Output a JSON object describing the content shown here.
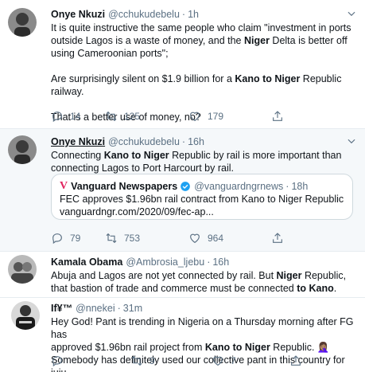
{
  "tweets": [
    {
      "name": "Onye Nkuzi",
      "handle": "@cchukudebelu",
      "time": "1h",
      "body": [
        [
          "It is quite instructive the same people who claim \"investment in ports outside Lagos is a waste of money, and the ",
          "Niger",
          " Delta is better off using Cameroonian ports\";"
        ],
        [
          "Are surprisingly silent on $1.9 billion for a ",
          "Kano to Niger",
          " Republic railway."
        ],
        [
          "That is a better use of money, no?"
        ]
      ],
      "replies": "14",
      "retweets": "125",
      "likes": "179"
    },
    {
      "name": "Onye Nkuzi",
      "handle": "@cchukudebelu",
      "time": "16h",
      "body_a": "Connecting ",
      "body_b": "Kano to Niger",
      "body_c": " Republic by rail is more important than connecting Lagos to Port Harcourt by rail.",
      "quote": {
        "source": "Vanguard Newspapers",
        "handle": "@vanguardngrnews",
        "time": "18h",
        "text": "FEC approves $1.96bn rail contract from Kano to Niger Republic",
        "link": "vanguardngr.com/2020/09/fec-ap..."
      },
      "replies": "79",
      "retweets": "753",
      "likes": "964"
    },
    {
      "name": "Kamala Obama",
      "handle": "@Ambrosia_ljebu",
      "time": "16h",
      "body_a": "Abuja and Lagos are not yet connected by rail. But ",
      "body_b": "Niger",
      "body_c": " Republic, that bastion of trade and commerce must be connected ",
      "body_d": "to Kano",
      "body_e": "."
    },
    {
      "name": "If¥™",
      "handle": "@nnekei",
      "time": "31m",
      "line1": "Hey God! Pant is trending in Nigeria on a Thursday morning after FG has",
      "line2a": "approved $1.96bn rail project from ",
      "line2b": "Kano to Niger",
      "line2c": " Republic. 🤦🏽‍♀️",
      "line3": "Somebody has definitely used our collective pant in this country for juju.",
      "retweets": "9",
      "likes": "7"
    }
  ],
  "icons": [
    "chevron-down-icon",
    "reply-icon",
    "retweet-icon",
    "like-icon",
    "share-icon",
    "verified-icon"
  ],
  "colors": {
    "secondary_text": "#5b7083",
    "border": "#e6ecf0",
    "verified": "#1da1f2",
    "vanguard_logo": "#e0245e"
  }
}
